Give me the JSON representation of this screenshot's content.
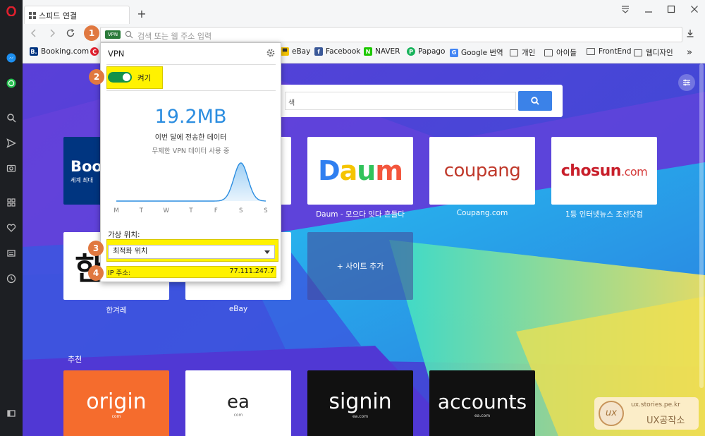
{
  "tab": {
    "title": "스피드 연결"
  },
  "address": {
    "vpn_badge": "VPN",
    "placeholder": "검색 또는 웹 주소 입력"
  },
  "bookmarks": [
    "Booking.com",
    "eBay",
    "Facebook",
    "NAVER",
    "Papago",
    "Google 번역",
    "개인",
    "아이들",
    "FrontEnd",
    "웹디자인"
  ],
  "bookmarks_more": "»",
  "vpn": {
    "title": "VPN",
    "toggle_label": "켜기",
    "data_amount": "19.2MB",
    "data_caption": "이번 달에 전송한 데이터",
    "unlimited": "무제한 VPN 데이터 사용 중",
    "days": [
      "M",
      "T",
      "W",
      "T",
      "F",
      "S",
      "S"
    ],
    "usage": [
      0,
      0,
      0,
      0,
      0,
      1,
      0
    ],
    "location_label": "가상 위치:",
    "location_value": "최적화 위치",
    "ip_label": "IP 주소:",
    "ip_value": "77.111.247.7"
  },
  "callouts": [
    "1",
    "2",
    "3",
    "4"
  ],
  "search_fragment": "색",
  "speed_dial": [
    {
      "label": "B",
      "logo": "Book",
      "logo_sub": "세계 최대"
    },
    {
      "label": "Daum - 모으다 잇다 흔들다"
    },
    {
      "label": "Coupang.com"
    },
    {
      "label": "1등 인터넷뉴스 조선닷컴"
    },
    {
      "label": "한겨레"
    },
    {
      "label": "eBay"
    }
  ],
  "add_site": "+ 사이트 추가",
  "recommend_title": "추천",
  "recommend": [
    {
      "logo": "origin",
      "sub": "com"
    },
    {
      "logo": "ea",
      "sub": "com"
    },
    {
      "logo": "signin",
      "sub": "ea.com"
    },
    {
      "logo": "accounts",
      "sub": "ea.com"
    }
  ],
  "logos": {
    "daum": "Daum",
    "coupang": "coupang",
    "chosun": "chosun",
    "chosun_com": ".com",
    "hani": "한"
  },
  "watermark": {
    "url": "ux.stories.pe.kr",
    "name": "UX공작소",
    "logo": "ux"
  },
  "colors": {
    "opera_red": "#e0202e",
    "vpn_green": "#14924a",
    "highlight": "#fff200",
    "callout": "#e07840",
    "accent_blue": "#2b8de0"
  }
}
